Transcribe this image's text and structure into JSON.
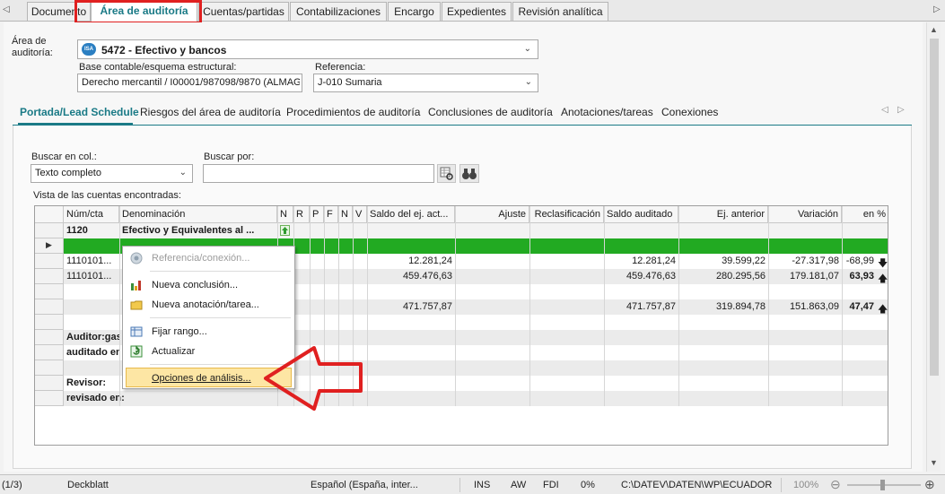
{
  "tabs": [
    {
      "label": "Documento",
      "active": false
    },
    {
      "label": "Área de auditoría",
      "active": true
    },
    {
      "label": "Cuentas/partidas",
      "active": false
    },
    {
      "label": "Contabilizaciones",
      "active": false
    },
    {
      "label": "Encargo",
      "active": false
    },
    {
      "label": "Expedientes",
      "active": false
    },
    {
      "label": "Revisión analítica",
      "active": false
    }
  ],
  "header": {
    "area_label_1": "Área de",
    "area_label_2": "auditoría:",
    "area_icon": "ISA",
    "area_value": "5472 - Efectivo y bancos",
    "base_label": "Base contable/esquema estructural:",
    "base_value": "Derecho mercantil / I00001/987098/9870 (ALMAGI",
    "ref_label": "Referencia:",
    "ref_value": "J-010  Sumaria"
  },
  "subtabs": [
    "Portada/Lead Schedule",
    "Riesgos del área de auditoría",
    "Procedimientos de auditoría",
    "Conclusiones de auditoría",
    "Anotaciones/tareas",
    "Conexiones"
  ],
  "search": {
    "col_label": "Buscar en col.:",
    "col_value": "Texto completo",
    "by_label": "Buscar por:",
    "by_value": "",
    "found_label": "Vista de las cuentas encontradas:"
  },
  "grid": {
    "headers": [
      "Núm/cta",
      "Denominación",
      "N",
      "R",
      "P",
      "F",
      "N",
      "V",
      "Saldo del ej. act...",
      "Ajuste",
      "Reclasificación",
      "Saldo auditado",
      "Ej. anterior",
      "Variación",
      "en %"
    ],
    "group_num": "1120",
    "group_name": "Efectivo y Equivalentes al ...",
    "rows": [
      {
        "num": "1110101...",
        "saldo": "12.281,24",
        "auditado": "12.281,24",
        "anterior": "39.599,22",
        "variacion": "-27.317,98",
        "pct": "-68,99",
        "dir": "down"
      },
      {
        "num": "1110101...",
        "saldo": "459.476,63",
        "auditado": "459.476,63",
        "anterior": "280.295,56",
        "variacion": "179.181,07",
        "pct": "63,93",
        "dir": "up"
      }
    ],
    "total": {
      "saldo": "471.757,87",
      "auditado": "471.757,87",
      "anterior": "319.894,78",
      "variacion": "151.863,09",
      "pct": "47,47",
      "dir": "up"
    },
    "auditor_1": "Auditor:gas",
    "auditor_2": "auditado en",
    "revisor_1": "Revisor:",
    "revisor_2": "revisado en:"
  },
  "context_menu": {
    "items": [
      {
        "label": "Referencia/conexión...",
        "icon": "link-icon",
        "disabled": true
      },
      {
        "label": "Nueva conclusión...",
        "icon": "conclusion-icon",
        "disabled": false
      },
      {
        "label": "Nueva anotación/tarea...",
        "icon": "folder-icon",
        "disabled": false
      },
      {
        "label": "Fijar rango...",
        "icon": "range-icon",
        "disabled": false
      },
      {
        "label": "Actualizar",
        "icon": "refresh-icon",
        "disabled": false
      },
      {
        "label": "Opciones de análisis...",
        "icon": "none",
        "disabled": false,
        "highlighted": true
      }
    ]
  },
  "status": {
    "page": "(1/3)",
    "doc": "Deckblatt",
    "lang": "Español (España, inter...",
    "ins": "INS",
    "aw": "AW",
    "fdi": "FDI",
    "pct": "0%",
    "path": "C:\\DATEV\\DATEN\\WP\\ECUADOR",
    "zoom": "100%"
  },
  "colors": {
    "accent": "#1a7a86",
    "highlight_red": "#e02020",
    "row_green": "#22aa22",
    "menu_highlight": "#fde6a4"
  }
}
